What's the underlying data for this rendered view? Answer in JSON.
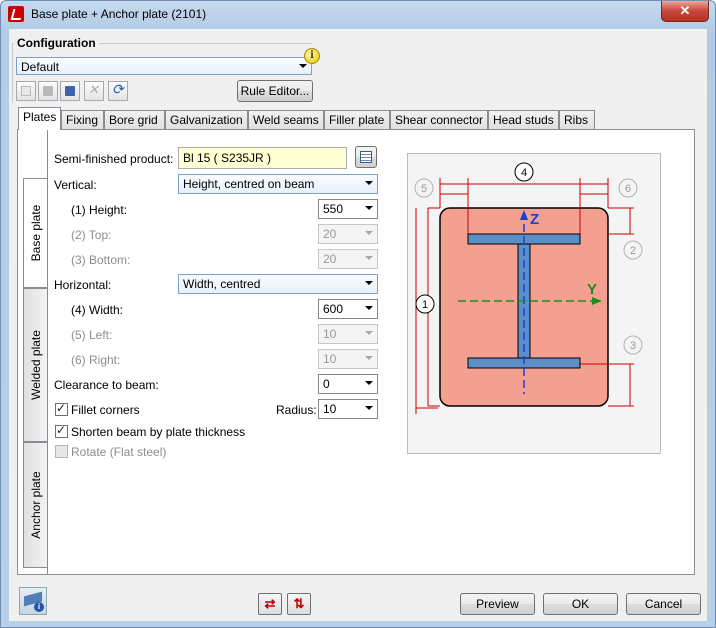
{
  "window": {
    "title": "Base plate + Anchor plate (2101)",
    "close": "✕"
  },
  "configuration": {
    "legend": "Configuration",
    "selected": "Default",
    "rule_editor": "Rule Editor..."
  },
  "tabs": [
    "Plates",
    "Fixing",
    "Bore grid",
    "Galvanization",
    "Weld seams",
    "Filler plate",
    "Shear connector",
    "Head studs",
    "Ribs"
  ],
  "side_tabs": [
    "Base plate",
    "Welded plate",
    "Anchor plate"
  ],
  "form": {
    "semi_finished_label": "Semi-finished product:",
    "semi_finished_value": "Bl 15  ( S235JR )",
    "vertical_label": "Vertical:",
    "vertical_value": "Height, centred on beam",
    "height_label": "(1) Height:",
    "height_value": "550",
    "top_label": "(2) Top:",
    "top_value": "20",
    "bottom_label": "(3) Bottom:",
    "bottom_value": "20",
    "horizontal_label": "Horizontal:",
    "horizontal_value": "Width, centred",
    "width_label": "(4) Width:",
    "width_value": "600",
    "left_label": "(5) Left:",
    "left_value": "10",
    "right_label": "(6) Right:",
    "right_value": "10",
    "clearance_label": "Clearance to beam:",
    "clearance_value": "0",
    "fillet_label": "Fillet corners",
    "radius_label": "Radius:",
    "radius_value": "10",
    "shorten_label": "Shorten beam by plate thickness",
    "rotate_label": "Rotate (Flat steel)"
  },
  "diagram": {
    "markers": [
      "1",
      "2",
      "3",
      "4",
      "5",
      "6"
    ],
    "axis_z": "Z",
    "axis_y": "Y",
    "colors": {
      "plate": "#f4a090",
      "beam": "#5b8fc7",
      "dim": "#cc0000",
      "axis_z": "#1a3fd6",
      "axis_y": "#1f8a1f"
    }
  },
  "buttons": {
    "preview": "Preview",
    "ok": "OK",
    "cancel": "Cancel"
  }
}
